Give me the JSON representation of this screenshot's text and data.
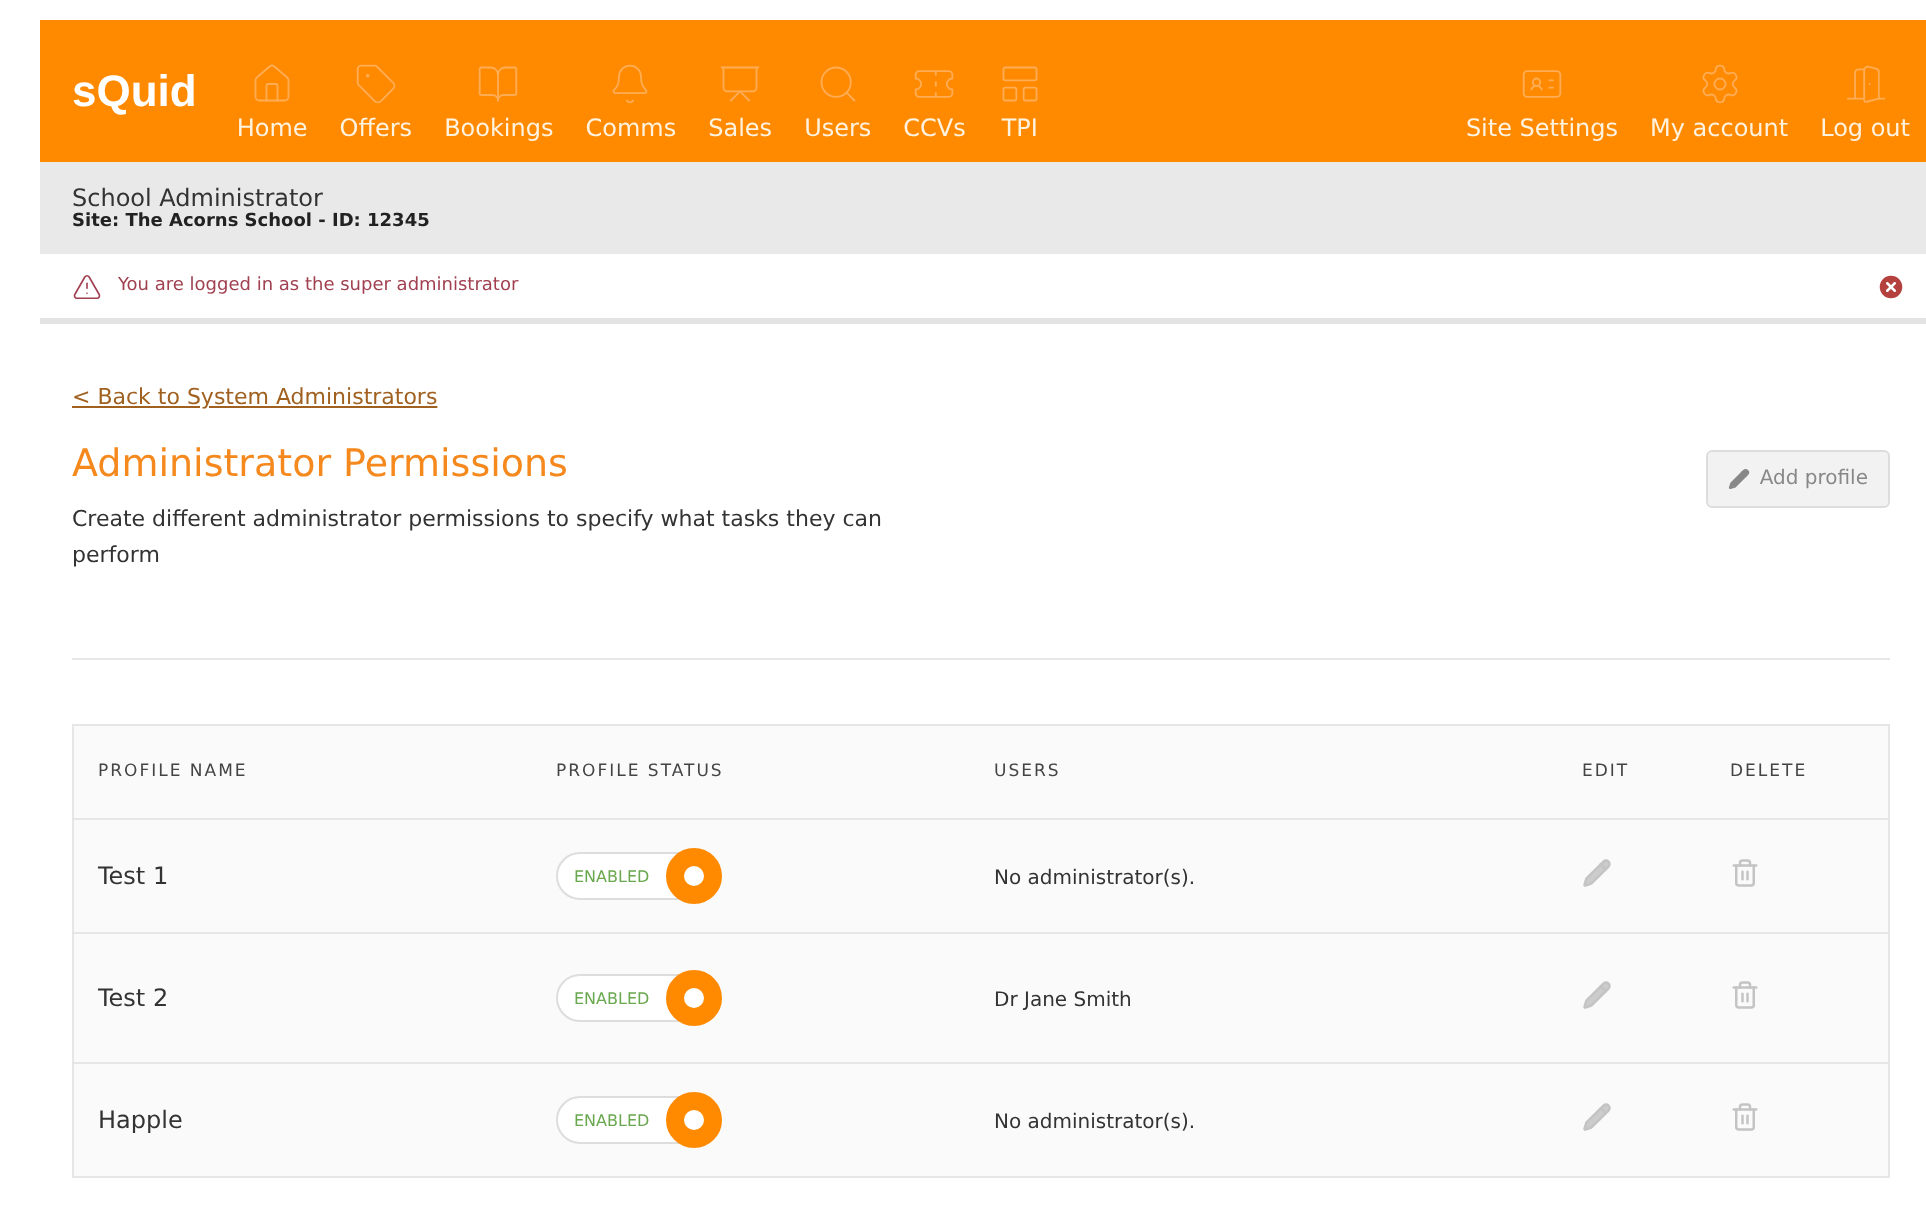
{
  "header": {
    "logo": "sQuid",
    "nav": [
      {
        "label": "Home"
      },
      {
        "label": "Offers"
      },
      {
        "label": "Bookings"
      },
      {
        "label": "Comms"
      },
      {
        "label": "Sales"
      },
      {
        "label": "Users"
      },
      {
        "label": "CCVs"
      },
      {
        "label": "TPI"
      }
    ],
    "right_nav": [
      {
        "label": "Site Settings"
      },
      {
        "label": "My account"
      },
      {
        "label": "Log out"
      }
    ]
  },
  "context": {
    "title": "School Administrator",
    "site": "Site: The Acorns School - ID:  12345"
  },
  "alert": {
    "message": "You are logged in as the super administrator"
  },
  "back_link": "< Back to System Administrators",
  "page": {
    "title": "Administrator Permissions",
    "description": "Create different administrator permissions to specify what tasks they can perform",
    "add_button": "Add profile"
  },
  "table": {
    "columns": [
      "PROFILE NAME",
      "PROFILE STATUS",
      "USERS",
      "EDIT",
      "DELETE"
    ],
    "rows": [
      {
        "name": "Test 1",
        "enabled": true,
        "status_label": "ENABLED",
        "users": "No administrator(s)."
      },
      {
        "name": "Test 2",
        "enabled": true,
        "status_label": "ENABLED",
        "users": "Dr Jane Smith"
      },
      {
        "name": "Happle",
        "enabled": true,
        "status_label": "ENABLED",
        "users": "No administrator(s)."
      }
    ]
  }
}
